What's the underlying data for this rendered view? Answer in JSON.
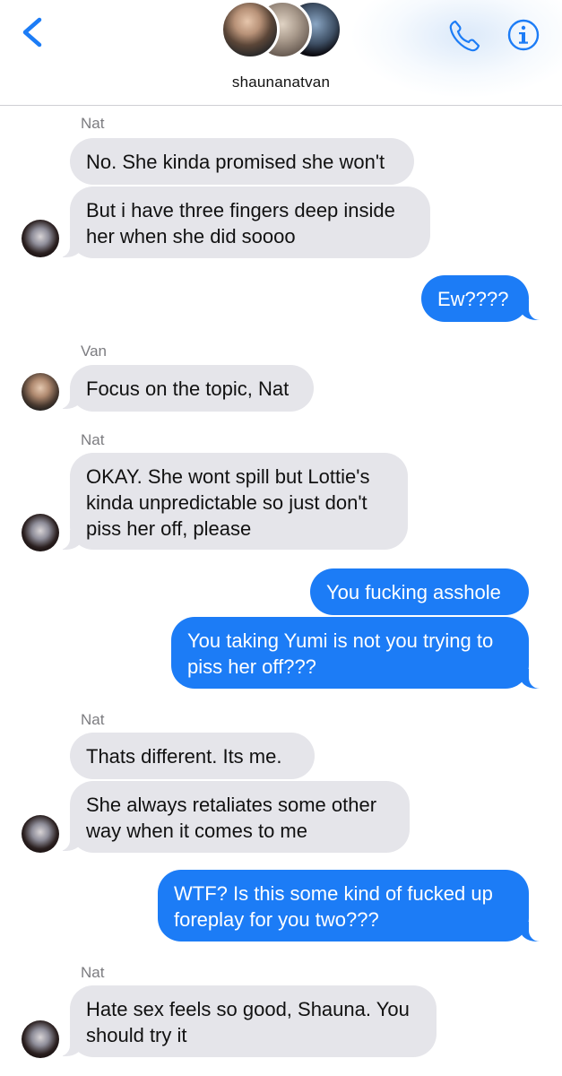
{
  "header": {
    "group_name": "shaunanatvan",
    "icons": {
      "back": "chevron-left-icon",
      "call": "phone-icon",
      "info": "info-circle-icon"
    },
    "accent": "#1c7cf6"
  },
  "colors": {
    "received_bubble": "#e5e5ea",
    "sent_bubble": "#1c7cf6",
    "sender_label": "#7c7c80"
  },
  "messages": [
    {
      "sender": "Nat",
      "text": "No. She kinda promised she won't"
    },
    {
      "text": "But i have three fingers deep inside\nher when she did soooo"
    },
    {
      "text": "Ew????"
    },
    {
      "sender": "Van",
      "text": "Focus on the topic, Nat"
    },
    {
      "sender": "Nat",
      "text": "OKAY. She wont spill but Lottie's\nkinda unpredictable so just don't\npiss her off, please"
    },
    {
      "text": "You fucking asshole"
    },
    {
      "text": "You taking Yumi is not you trying to\npiss her off???"
    },
    {
      "sender": "Nat",
      "text": "Thats different. Its me."
    },
    {
      "text": "She always retaliates some other\nway when it comes to me"
    },
    {
      "text": "WTF? Is this some kind of fucked up\nforeplay for you two???"
    },
    {
      "sender": "Nat",
      "text": "Hate sex feels so good, Shauna. You\nshould try it"
    }
  ]
}
